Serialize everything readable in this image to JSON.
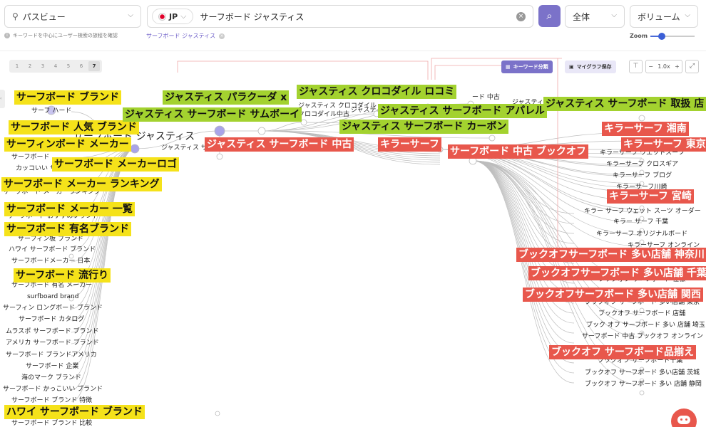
{
  "toolbar": {
    "view_mode": "パスビュー",
    "country": "JP",
    "search_value": "サーフボード ジャスティス",
    "scope": "全体",
    "metric": "ボリューム"
  },
  "hint_text": "キーワードを中心にユーザー検索の旅程を確認",
  "breadcrumb": "サーフボード ジャスティス",
  "zoom_label": "Zoom",
  "zoom_level": 0.25,
  "pages": [
    "1",
    "2",
    "3",
    "4",
    "5",
    "6",
    "7"
  ],
  "active_page": "7",
  "buttons": {
    "keyword_class": "キーワード分類",
    "save_graph": "マイグラフ保存",
    "zoom_value": "1.0x",
    "zoom_minus": "−",
    "zoom_plus": "+"
  },
  "center_keyword": "サーフボード ジャスティス",
  "yellow_labels": [
    "サーフボード ブランド",
    "サーフボード 人気 ブランド",
    "サーフィンボード メーカー",
    "サーフボード メーカーロゴ",
    "サーフボード メーカー ランキング",
    "サーフボード メーカー 一覧",
    "サーフボード 有名ブランド",
    "サーフボード 流行り",
    "ハワイ サーフボード ブランド"
  ],
  "green_labels": [
    "ジャスティス パラクーダ x",
    "ジャスティス クロコダイル ロコミ",
    "ジャスティス サーフボード サムボーイ",
    "ジャスティス サーフボード アパレル",
    "ジャスティス サーフボード 取扱 店",
    "ジャスティス サーフボード カーボン"
  ],
  "red_labels": [
    "ジャスティス サーフボード 中古",
    "キラーサーフ",
    "サーフボード 中古 ブックオフ",
    "キラーサーフ 湘南",
    "キラーサーフ 東京",
    "キラーサーフ 宮崎",
    "ブックオフサーフボード 多い店舗 神奈川",
    "ブックオフサーフボード 多い店舗 千葉",
    "ブックオフサーフボード 多い店舗 関西",
    "ブックオフ サーフボード品揃え"
  ],
  "left_nodes": [
    "サーフ ハード",
    "サーフボード",
    "カッコいい サーフボード",
    "サーフボード メーカーランキング",
    "サーフボード おすすめブランド",
    "サーフィン板 ブランド",
    "ハワイ サーフボード ブランド",
    "サーフボードメーカー 日本",
    "サーフボード 有名 メーカー",
    "surfboard brand",
    "サーフィン ロングボード ブランド",
    "サーフボード カタログ",
    "ムラスポ サーフボード ブランド",
    "アメリカ サーフボード ブランド",
    "サーフボード ブランドアメリカ",
    "サーフボード 企業",
    "海のマーク ブランド",
    "サーフボード かっこいい ブランド",
    "サーフボード ブランド 特徴",
    "サーフボード ブランド 比較"
  ],
  "right_nodes": [
    "キラーサーフ ウエットスーツ",
    "キラーサーフ クロスギア",
    "キラーサーフ ブログ",
    "キラーサーフ川崎",
    "キラー サーフ ウェット スーツ オーダー",
    "キラー サーフ 千葉",
    "キラーサーフ オリジナルボード",
    "キラーサーフ オンライン",
    "ブックオフ サーフボード 仕様",
    "ブックオフ サーフボード 多い店舗 東京",
    "ブックオフ サーフボード 店舗",
    "ブック オフ サーフボード 多い 店舗 埼玉",
    "サーフボード 中古 ブックオフ オンライン",
    "ブックオフ サーフボード千葉",
    "ブックオフ サーフボード 多い店舗 茨城",
    "ブックオフ サーフボード 多い 店舗 静岡"
  ],
  "mid_nodes": [
    "ジャスティス サ",
    "ジャスティス クロコダイル",
    "クロコダイル中古",
    "ジャスティス",
    "ード 中古",
    "ジャスティ"
  ],
  "colors": {
    "accent": "#7b72c9",
    "yellow": "#f5e21a",
    "green": "#a3d22f",
    "red": "#e8574c",
    "node": "#a9a4e8"
  }
}
